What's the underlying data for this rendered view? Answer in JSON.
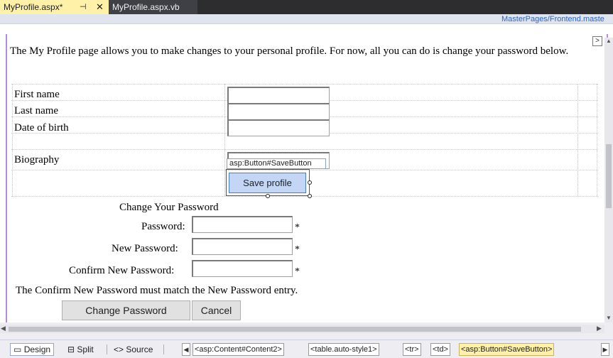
{
  "tabs": [
    {
      "label": "MyProfile.aspx*",
      "pin_icon": "pin-icon",
      "close_icon": "close-icon"
    },
    {
      "label": "MyProfile.aspx.vb"
    }
  ],
  "master_page": "MasterPages/Frontend.maste",
  "intro_text": "The My Profile page allows you to make changes to your personal profile. For now, all you can do is change your password below.",
  "profile_form": {
    "first_name_label": "First name",
    "last_name_label": "Last name",
    "dob_label": "Date of birth",
    "biography_label": "Biography",
    "tag_tooltip": "asp:Button#SaveButton",
    "save_label": "Save profile"
  },
  "password_form": {
    "heading": "Change Your Password",
    "password_label": "Password:",
    "new_password_label": "New Password:",
    "confirm_label": "Confirm New Password:",
    "required_marker": "*",
    "compare_message": "The Confirm New Password must match the New Password entry.",
    "change_button": "Change Password",
    "cancel_button": "Cancel"
  },
  "view_buttons": {
    "design": "Design",
    "split": "Split",
    "source": "Source",
    "design_icon": "▭",
    "split_icon": "⊟",
    "source_icon": "<>"
  },
  "breadcrumbs": [
    "<asp:Content#Content2>",
    "<table.auto-style1>",
    "<tr>",
    "<td>",
    "<asp:Button#SaveButton>"
  ],
  "arrows": {
    "left": "◀",
    "right": "▶",
    "expand": ">"
  }
}
